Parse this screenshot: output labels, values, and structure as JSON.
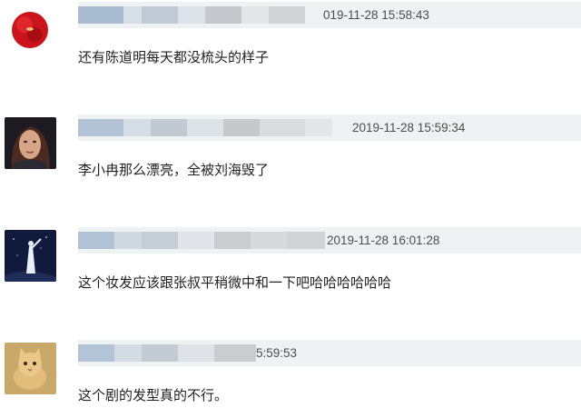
{
  "comments": [
    {
      "username_masked": "",
      "timestamp": "019-11-28 15:58:43",
      "text": "还有陈道明每天都没梳头的样子",
      "avatar_icon": "red-rose-avatar"
    },
    {
      "username_masked": "",
      "timestamp": "2019-11-28 15:59:34",
      "text": "李小冉那么漂亮，全被刘海毁了",
      "avatar_icon": "woman-portrait-avatar"
    },
    {
      "username_masked": "",
      "timestamp": "2019-11-28 16:01:28",
      "text": "这个妆发应该跟张叔平稍微中和一下吧哈哈哈哈哈哈",
      "avatar_icon": "night-sky-figure-avatar"
    },
    {
      "username_masked": "",
      "timestamp": "5:59:53",
      "text": "这个剧的发型真的不行。",
      "avatar_icon": "cat-avatar"
    }
  ]
}
